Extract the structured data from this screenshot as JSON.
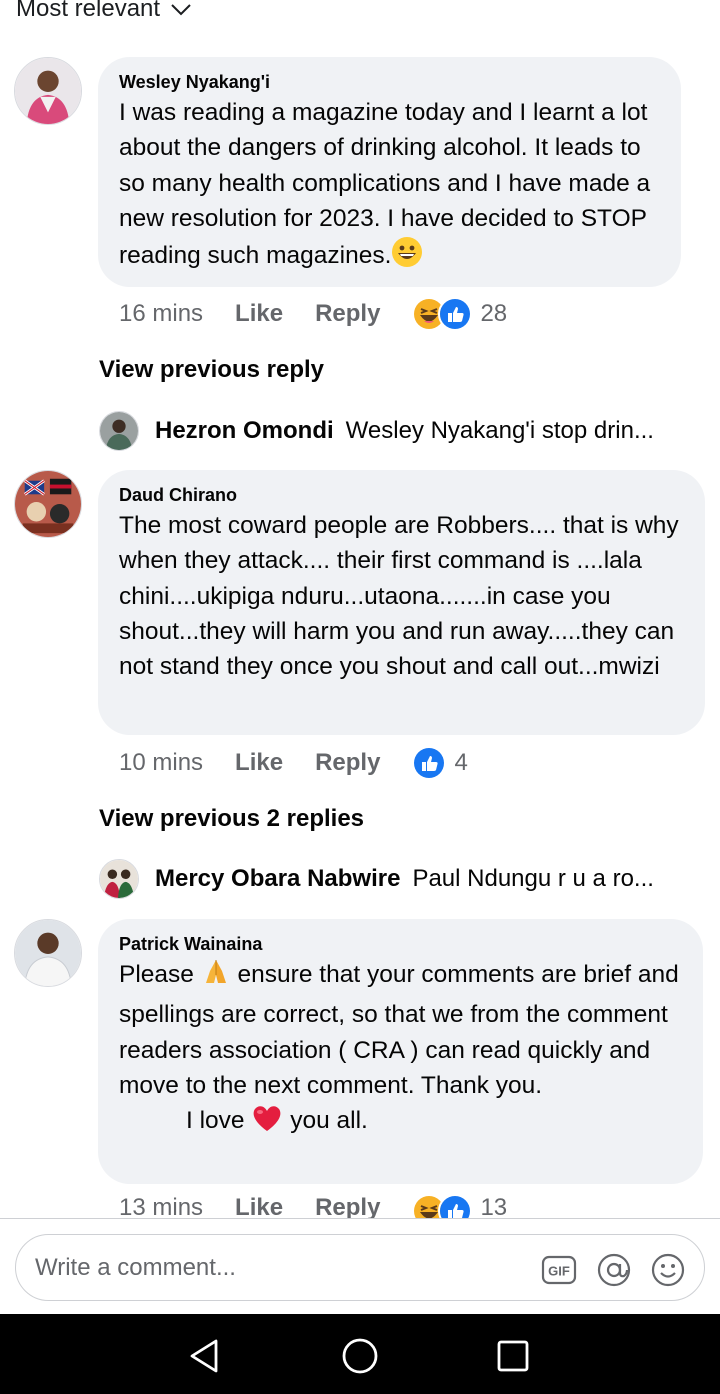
{
  "sort": {
    "label": "Most relevant"
  },
  "comments": [
    {
      "author": "Wesley Nyakang'i",
      "text": "I was reading a magazine today and I learnt a lot about the dangers of drinking alcohol. It leads to so many health complications and I have made a new resolution for 2023. I have decided to STOP reading such magazines.",
      "time": "16 mins",
      "like_label": "Like",
      "reply_label": "Reply",
      "reactions": [
        "haha-icon",
        "like-icon"
      ],
      "reaction_count": "28",
      "view_previous": "View previous reply",
      "reply_preview": {
        "author": "Hezron Omondi",
        "text": "Wesley Nyakang'i stop drin..."
      }
    },
    {
      "author": "Daud Chirano",
      "text": "The most coward people are Robbers.... that is why when they attack.... their first command is ....lala chini....ukipiga nduru...utaona.......in case you shout...they will harm you and run away.....they can not stand they once you shout and call out...mwizi",
      "time": "10 mins",
      "like_label": "Like",
      "reply_label": "Reply",
      "reactions": [
        "like-icon"
      ],
      "reaction_count": "4",
      "view_previous": "View previous 2 replies",
      "reply_preview": {
        "author": "Mercy Obara Nabwire",
        "text": "Paul Ndungu r u a ro..."
      }
    },
    {
      "author": "Patrick Wainaina",
      "text_part1": "Please",
      "text_part2": "ensure that your comments are brief and spellings are correct, so that we from the comment readers association ( CRA ) can read quickly and move to the next comment. Thank you.",
      "text_line_love_a": "I love",
      "text_line_love_b": "you all.",
      "time": "13 mins",
      "like_label": "Like",
      "reply_label": "Reply",
      "reactions": [
        "haha-icon",
        "like-icon"
      ],
      "reaction_count": "13"
    }
  ],
  "composer": {
    "placeholder": "Write a comment...",
    "icons": [
      "gif-icon",
      "at-mention-icon",
      "emoji-icon"
    ]
  },
  "navbar": {
    "icons": [
      "back-triangle-icon",
      "home-circle-icon",
      "recents-square-icon"
    ]
  },
  "colors": {
    "bubble": "#f0f2f5",
    "meta_text": "#65676b",
    "like_blue": "#1877f2",
    "haha_yellow": "#f7b125",
    "heart_red": "#e41e3f"
  }
}
